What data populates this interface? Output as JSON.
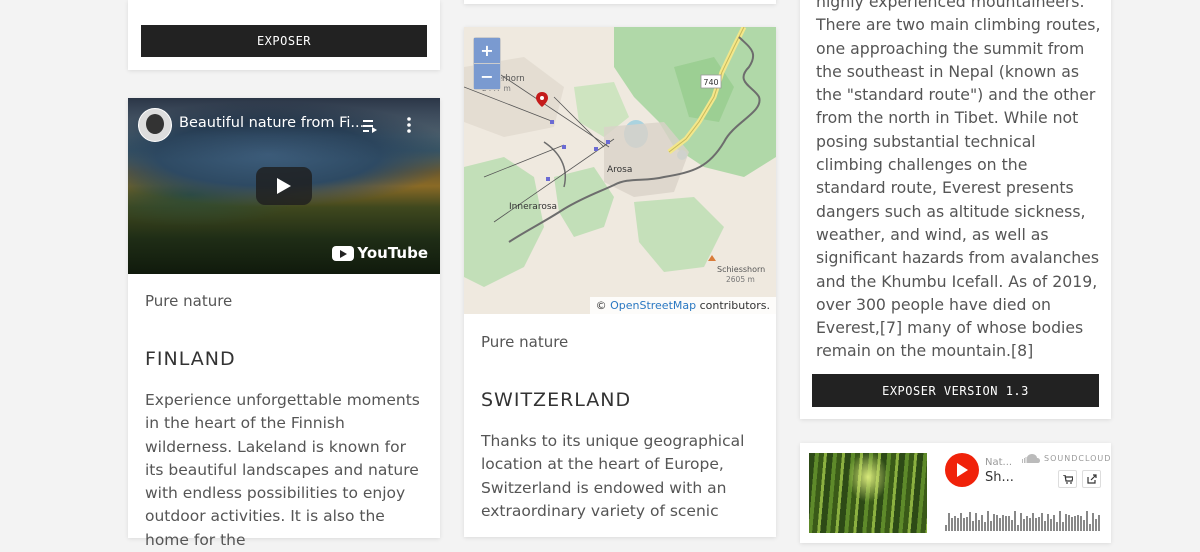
{
  "col1": {
    "top_button_label": "EXPOSER",
    "video": {
      "title": "Beautiful nature from Fi...",
      "brand": "YouTube"
    },
    "subtitle": "Pure nature",
    "title": "FINLAND",
    "text": "Experience unforgettable moments in the heart of the Finnish wilderness. Lakeland is known for its beautiful landscapes and nature with endless possibilities to enjoy outdoor activities. It is also the home for the"
  },
  "col2": {
    "map": {
      "zoom_in": "+",
      "zoom_out": "−",
      "labels": {
        "peak_left": "Bergerhorn",
        "peak_left_alt": "2447 m",
        "road": "740",
        "town": "Arosa",
        "village": "Innerarosa",
        "peak_right": "Schiesshorn",
        "peak_right_alt": "2605 m"
      },
      "attribution_prefix": "©",
      "attribution_link": "OpenStreetMap",
      "attribution_suffix": "contributors."
    },
    "subtitle": "Pure nature",
    "title": "SWITZERLAND",
    "text": "Thanks to its unique geographical location at the heart of Europe, Switzerland is endowed with an extraordinary variety of scenic"
  },
  "col3": {
    "text": "highly experienced mountaineers. There are two main climbing routes, one approaching the summit from the southeast in Nepal (known as the \"standard route\") and the other from the north in Tibet. While not posing substantial technical climbing challenges on the standard route, Everest presents dangers such as altitude sickness, weather, and wind, as well as significant hazards from avalanches and the Khumbu Icefall. As of 2019, over 300 people have died on Everest,[7] many of whose bodies remain on the mountain.[8]",
    "button_label": "EXPOSER VERSION 1.3",
    "soundcloud": {
      "artist": "Nat...",
      "track": "Sh...",
      "brand": "SOUNDCLOUD"
    }
  },
  "colors": {
    "button_bg": "#222222",
    "link": "#2a78c2",
    "soundcloud_orange": "#f0220a"
  }
}
